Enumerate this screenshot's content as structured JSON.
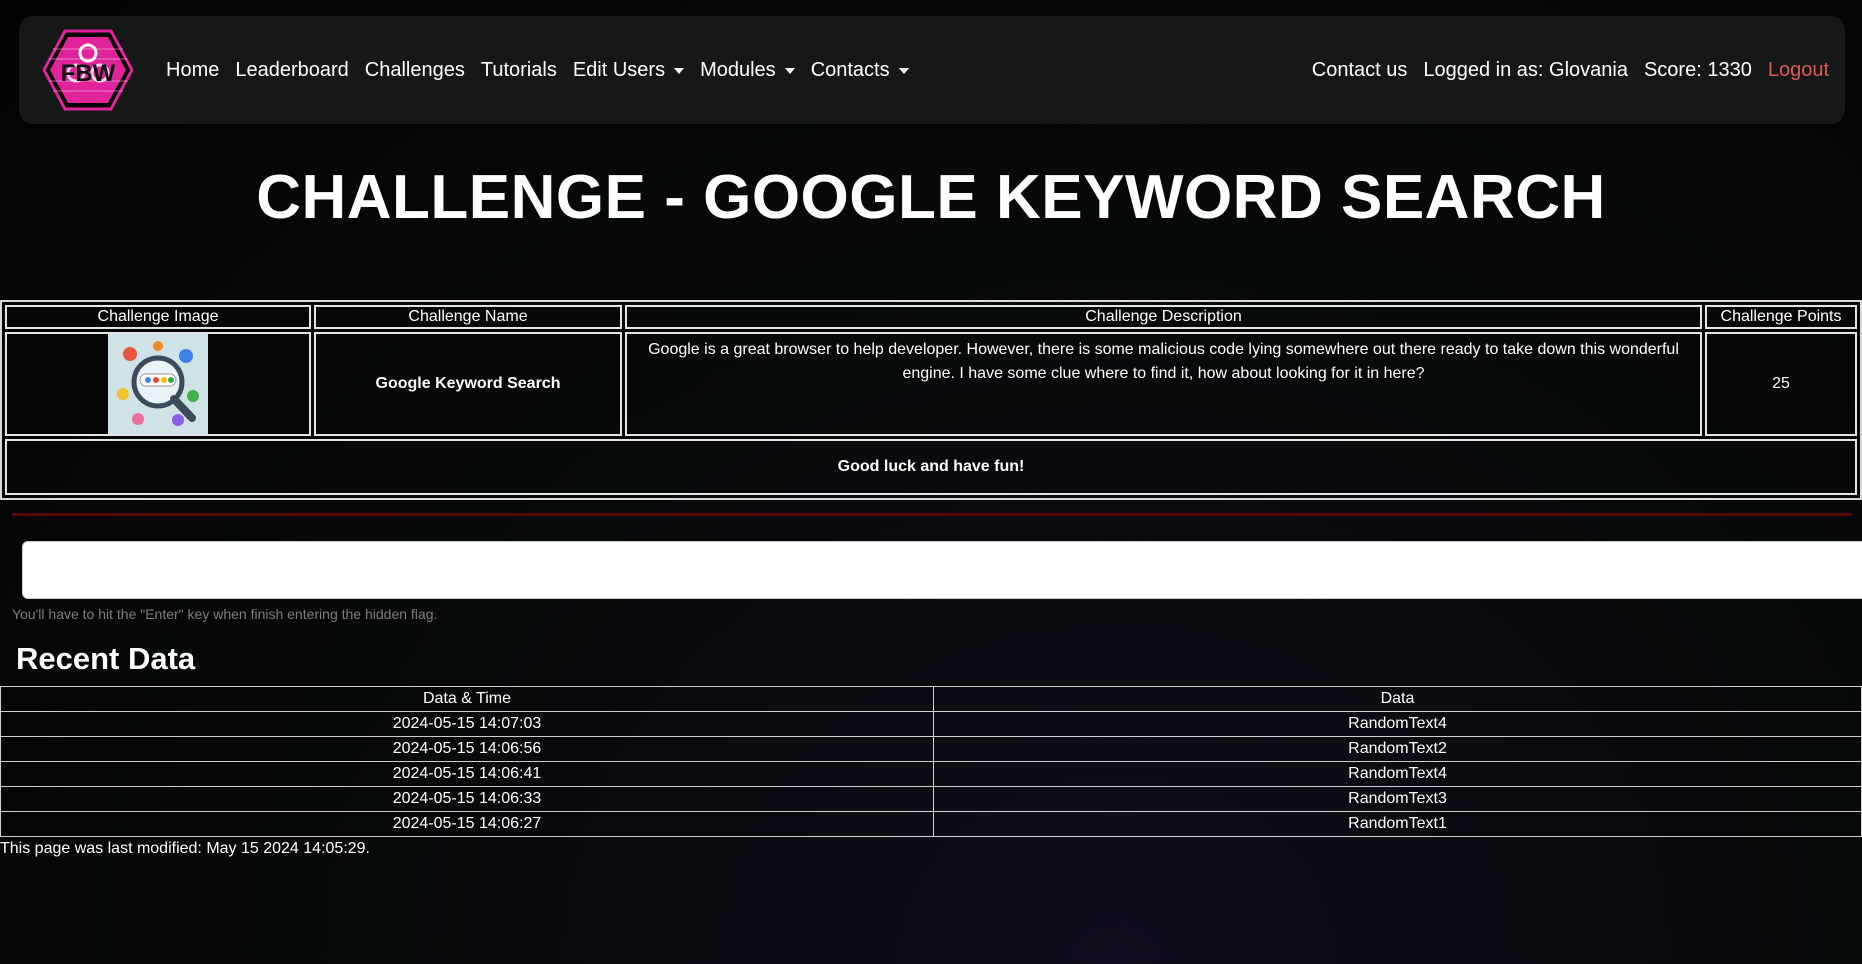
{
  "nav": {
    "logo_text": "FBW",
    "links": [
      {
        "label": "Home"
      },
      {
        "label": "Leaderboard"
      },
      {
        "label": "Challenges"
      },
      {
        "label": "Tutorials"
      },
      {
        "label": "Edit Users"
      },
      {
        "label": "Modules"
      },
      {
        "label": "Contacts"
      }
    ],
    "contact_us": "Contact us",
    "logged_in": "Logged in as: Glovania",
    "score": "Score: 1330",
    "logout": "Logout"
  },
  "page_title": "CHALLENGE - GOOGLE KEYWORD SEARCH",
  "challenge_table": {
    "headers": [
      "Challenge Image",
      "Challenge Name",
      "Challenge Description",
      "Challenge Points"
    ],
    "name": "Google Keyword Search",
    "description": "Google is a great browser to help developer. However, there is some malicious code lying somewhere out there ready to take down this wonderful engine. I have some clue where to find it, how about looking for it in here?",
    "points": "25",
    "footer_message": "Good luck and have fun!"
  },
  "flag_input": {
    "value": "",
    "hint": "You'll have to hit the \"Enter\" key when finish entering the hidden flag."
  },
  "recent": {
    "title": "Recent Data",
    "headers": [
      "Data & Time",
      "Data"
    ],
    "rows": [
      [
        "2024-05-15 14:07:03",
        "RandomText4"
      ],
      [
        "2024-05-15 14:06:56",
        "RandomText2"
      ],
      [
        "2024-05-15 14:06:41",
        "RandomText4"
      ],
      [
        "2024-05-15 14:06:33",
        "RandomText3"
      ],
      [
        "2024-05-15 14:06:27",
        "RandomText1"
      ]
    ]
  },
  "footer": "This page was last modified: May 15 2024 14:05:29.",
  "colors": {
    "logo_pink": "#e0239b",
    "logout": "#e05a54",
    "success": "#1f9a57",
    "divider": "#5a0707"
  }
}
